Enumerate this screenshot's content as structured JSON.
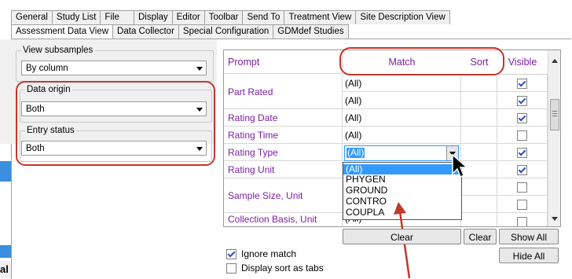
{
  "tabs_row1": [
    "General",
    "Study List",
    "File",
    "Display",
    "Editor",
    "Toolbar",
    "Send To",
    "Treatment View",
    "Site Description View"
  ],
  "tabs_row2": [
    "Assessment Data View",
    "Data Collector",
    "Special Configuration",
    "GDMdef Studies"
  ],
  "left": {
    "view_subsamples": {
      "label": "View subsamples",
      "value": "By column"
    },
    "data_origin": {
      "label": "Data origin",
      "value": "Both"
    },
    "entry_status": {
      "label": "Entry status",
      "value": "Both"
    }
  },
  "grid": {
    "headers": {
      "prompt": "Prompt",
      "match": "Match",
      "sort": "Sort",
      "visible": "Visible"
    },
    "rows": [
      {
        "prompt": "Part Rated",
        "match": [
          "(All)",
          "(All)"
        ],
        "visible": [
          true,
          true
        ]
      },
      {
        "prompt": "Rating Date",
        "match": [
          "(All)"
        ],
        "visible": [
          true
        ]
      },
      {
        "prompt": "Rating Time",
        "match": [
          "(All)"
        ],
        "visible": [
          false
        ]
      },
      {
        "prompt": "Rating Type",
        "match": [
          "(All)"
        ],
        "visible": [
          true
        ]
      },
      {
        "prompt": "Rating Unit",
        "match": [
          ""
        ],
        "visible": [
          true
        ]
      },
      {
        "prompt": "Sample Size, Unit",
        "match": [
          "",
          ""
        ],
        "visible": [
          false,
          false
        ]
      },
      {
        "prompt": "Collection Basis, Unit",
        "match": [
          "(All)"
        ],
        "visible": [
          false
        ]
      }
    ],
    "dropdown_options": [
      "(All)",
      "PHYGEN",
      "GROUND",
      "CONTRO",
      "COUPLA"
    ]
  },
  "buttons": {
    "clear_match": "Clear",
    "clear_sort": "Clear",
    "show_all": "Show All",
    "hide_all": "Hide All"
  },
  "options": {
    "ignore_match": {
      "label": "Ignore match",
      "checked": true
    },
    "display_sort_as_tabs": {
      "label": "Display sort as tabs",
      "checked": false
    }
  },
  "colors": {
    "accent_red": "#c0392b",
    "prompt_purple": "#7b1fa2",
    "selection_blue": "#3399ff"
  }
}
